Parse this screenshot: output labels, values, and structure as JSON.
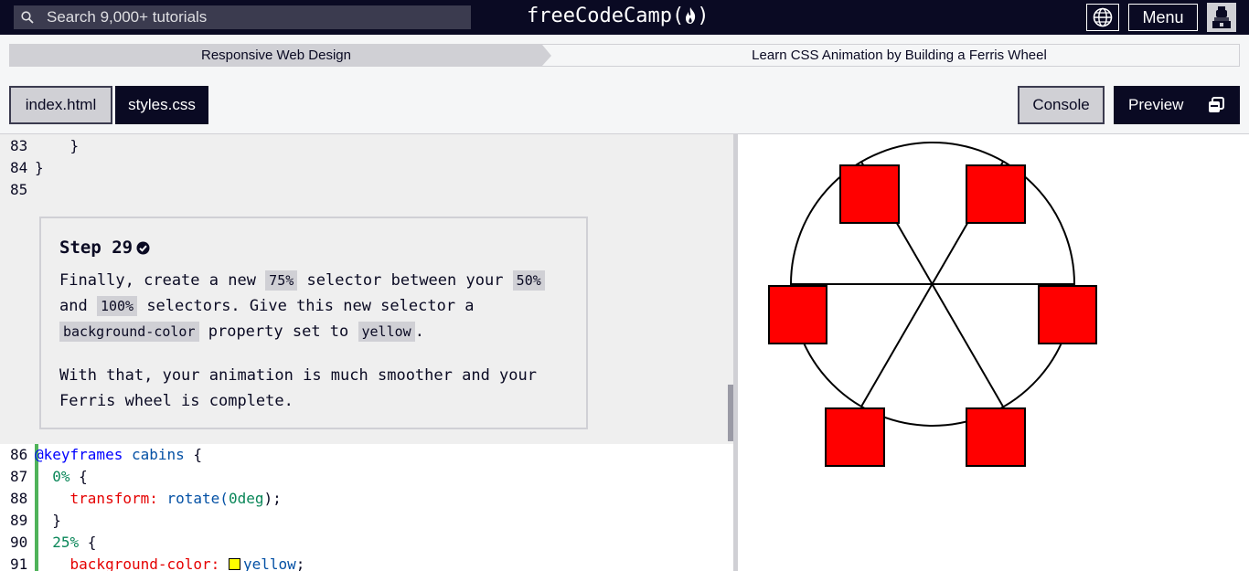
{
  "nav": {
    "search_placeholder": "Search 9,000+ tutorials",
    "logo_text": "freeCodeCamp(",
    "logo_close": ")",
    "menu_label": "Menu"
  },
  "breadcrumb": {
    "course": "Responsive Web Design",
    "project": "Learn CSS Animation by Building a Ferris Wheel"
  },
  "tabs": {
    "index": "index.html",
    "styles": "styles.css",
    "console": "Console",
    "preview": "Preview"
  },
  "code_top": [
    {
      "n": "83",
      "t": "    }"
    },
    {
      "n": "84",
      "t": "}"
    },
    {
      "n": "85",
      "t": ""
    }
  ],
  "code_bottom": {
    "l86": {
      "n": "86",
      "kw": "@keyframes",
      "name": " cabins",
      "rest": " {"
    },
    "l87": {
      "n": "87",
      "indent": "  ",
      "pct": "0%",
      "rest": " {"
    },
    "l88": {
      "n": "88",
      "indent": "    ",
      "prop": "transform:",
      "sp": " ",
      "fn": "rotate(",
      "num": "0deg",
      "rest": ");"
    },
    "l89": {
      "n": "89",
      "t": "  }"
    },
    "l90": {
      "n": "90",
      "indent": "  ",
      "pct": "25%",
      "rest": " {"
    },
    "l91": {
      "n": "91",
      "indent": "    ",
      "prop": "background-color:",
      "sp": " ",
      "val": "yellow",
      "rest": ";"
    }
  },
  "step": {
    "title": "Step 29",
    "p1_a": "Finally, create a new ",
    "p1_code1": "75%",
    "p1_b": " selector between your ",
    "p1_code2": "50%",
    "p1_c": " and ",
    "p1_code3": "100%",
    "p1_d": " selectors. Give this new selector a ",
    "p1_code4": "background-color",
    "p1_e": " property set to ",
    "p1_code5": "yellow",
    "p1_f": ".",
    "p2": "With that, your animation is much smoother and your Ferris wheel is complete."
  },
  "colors": {
    "nav_bg": "#0a0a23",
    "cabin": "#ff0000",
    "diff_bar": "#4fb35a"
  },
  "preview": {
    "cabin_color": "#ff0000",
    "cabin_count": 6
  }
}
